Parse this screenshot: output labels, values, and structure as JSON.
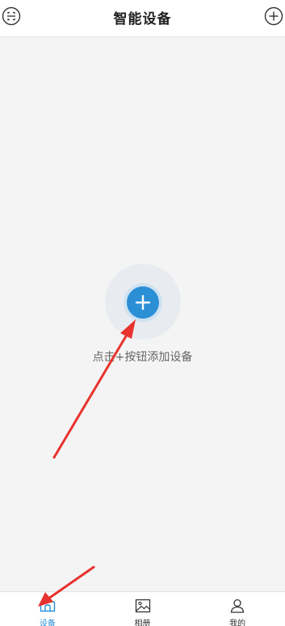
{
  "header": {
    "title": "智能设备",
    "left_icon": "scan-icon",
    "right_icon": "plus-circle-icon"
  },
  "main": {
    "add_icon": "plus-icon",
    "hint": "点击+按钮添加设备"
  },
  "tabbar": {
    "tabs": [
      {
        "label": "设备",
        "icon": "device-icon",
        "active": true
      },
      {
        "label": "相册",
        "icon": "album-icon",
        "active": false
      },
      {
        "label": "我的",
        "icon": "user-icon",
        "active": false
      }
    ]
  },
  "colors": {
    "accent": "#2b8fd6",
    "annotation_arrow": "#e8322d",
    "background": "#f4f4f4"
  }
}
